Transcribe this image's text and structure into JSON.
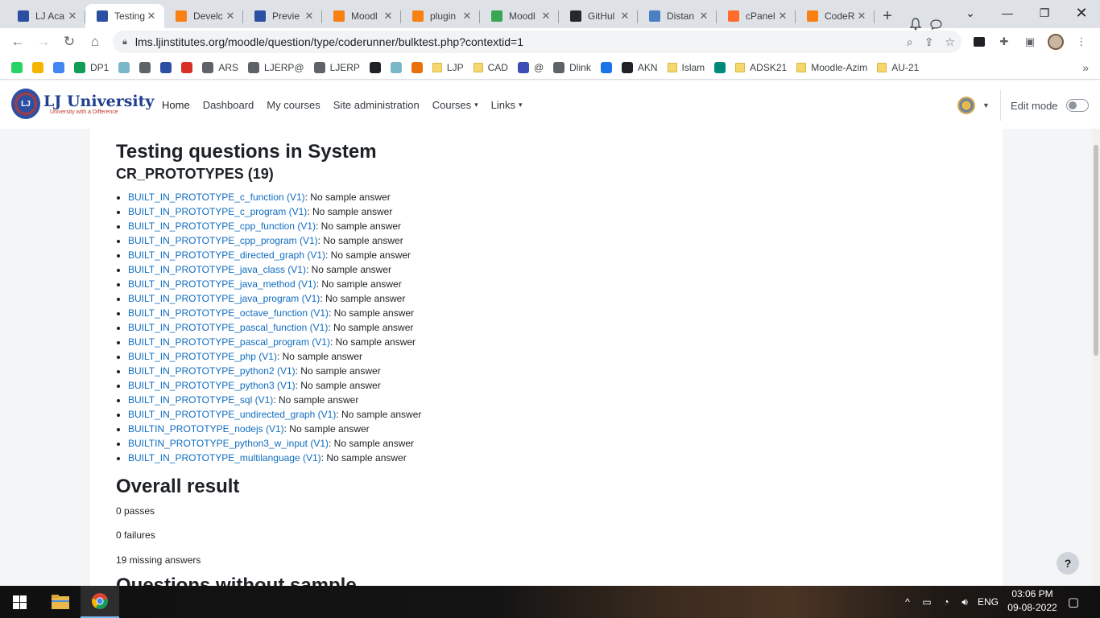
{
  "browser": {
    "tabs": [
      {
        "label": "LJ Aca",
        "icon": "shield-favicon",
        "color": "#2d4fa3",
        "active": false
      },
      {
        "label": "Testing",
        "icon": "shield-favicon",
        "color": "#2d4fa3",
        "active": true
      },
      {
        "label": "Develc",
        "icon": "moodle-favicon",
        "color": "#f98012",
        "active": false
      },
      {
        "label": "Previe",
        "icon": "shield-favicon",
        "color": "#2d4fa3",
        "active": false
      },
      {
        "label": "Moodl",
        "icon": "moodle-favicon",
        "color": "#f98012",
        "active": false
      },
      {
        "label": "plugin",
        "icon": "moodle-favicon",
        "color": "#f98012",
        "active": false
      },
      {
        "label": "Moodl",
        "icon": "moodle-green-favicon",
        "color": "#3aa655",
        "active": false
      },
      {
        "label": "GitHul",
        "icon": "github-favicon",
        "color": "#24292f",
        "active": false
      },
      {
        "label": "Distan",
        "icon": "doc-favicon",
        "color": "#4a7fc1",
        "active": false
      },
      {
        "label": "cPanel",
        "icon": "cpanel-favicon",
        "color": "#ff6c2c",
        "active": false
      },
      {
        "label": "CodeR",
        "icon": "moodle-favicon",
        "color": "#f98012",
        "active": false
      }
    ],
    "url": "lms.ljinstitutes.org/moodle/question/type/coderunner/bulktest.php?contextid=1",
    "bookmarks": [
      {
        "label": "",
        "icon": "whatsapp-icon",
        "color": "#25d366",
        "type": "icon"
      },
      {
        "label": "",
        "icon": "drive-icon",
        "color": "#f4b400",
        "type": "icon"
      },
      {
        "label": "",
        "icon": "google-icon",
        "color": "#4285f4",
        "type": "icon"
      },
      {
        "label": "DP1",
        "icon": "drive-icon",
        "color": "#0f9d58",
        "type": "icon"
      },
      {
        "label": "",
        "icon": "globe-icon",
        "color": "#7ab8c9",
        "type": "icon"
      },
      {
        "label": "",
        "icon": "globe-icon",
        "color": "#5f6368",
        "type": "icon"
      },
      {
        "label": "",
        "icon": "shield-icon",
        "color": "#2d4fa3",
        "type": "icon"
      },
      {
        "label": "",
        "icon": "bus-icon",
        "color": "#d93025",
        "type": "icon"
      },
      {
        "label": "ARS",
        "icon": "globe-icon",
        "color": "#5f6368",
        "type": "icon"
      },
      {
        "label": "LJERP@",
        "icon": "globe-icon",
        "color": "#5f6368",
        "type": "icon"
      },
      {
        "label": "LJERP",
        "icon": "globe-icon",
        "color": "#5f6368",
        "type": "icon"
      },
      {
        "label": "",
        "icon": "flame-icon",
        "color": "#202124",
        "type": "icon"
      },
      {
        "label": "",
        "icon": "globe-icon",
        "color": "#7ab8c9",
        "type": "icon"
      },
      {
        "label": "",
        "icon": "flame-icon",
        "color": "#e8710a",
        "type": "icon"
      },
      {
        "label": "LJP",
        "icon": "folder-icon",
        "color": "#f5d76e",
        "type": "folder"
      },
      {
        "label": "CAD",
        "icon": "folder-icon",
        "color": "#f5d76e",
        "type": "folder"
      },
      {
        "label": "@",
        "icon": "calendar-icon",
        "color": "#3c4db5",
        "type": "icon"
      },
      {
        "label": "Dlink",
        "icon": "globe-icon",
        "color": "#5f6368",
        "type": "icon"
      },
      {
        "label": "",
        "icon": "download-icon",
        "color": "#1a73e8",
        "type": "icon"
      },
      {
        "label": "AKN",
        "icon": "swoosh-icon",
        "color": "#202124",
        "type": "icon"
      },
      {
        "label": "Islam",
        "icon": "folder-icon",
        "color": "#f5d76e",
        "type": "folder"
      },
      {
        "label": "",
        "icon": "meet-icon",
        "color": "#00897b",
        "type": "icon"
      },
      {
        "label": "ADSK21",
        "icon": "folder-icon",
        "color": "#f5d76e",
        "type": "folder"
      },
      {
        "label": "Moodle-Azim",
        "icon": "folder-icon",
        "color": "#f5d76e",
        "type": "folder"
      },
      {
        "label": "AU-21",
        "icon": "folder-icon",
        "color": "#f5d76e",
        "type": "folder"
      }
    ]
  },
  "moodle": {
    "logo_name": "LJ University",
    "logo_tagline": "University with a Difference",
    "nav": [
      {
        "label": "Home",
        "active": true,
        "caret": false
      },
      {
        "label": "Dashboard",
        "active": false,
        "caret": false
      },
      {
        "label": "My courses",
        "active": false,
        "caret": false
      },
      {
        "label": "Site administration",
        "active": false,
        "caret": false
      },
      {
        "label": "Courses",
        "active": false,
        "caret": true
      },
      {
        "label": "Links",
        "active": false,
        "caret": true
      }
    ],
    "edit_mode_label": "Edit mode"
  },
  "page": {
    "title": "Testing questions in System",
    "category": "CR_PROTOTYPES (19)",
    "questions": [
      {
        "name": "BUILT_IN_PROTOTYPE_c_function (V1)",
        "result": ": No sample answer"
      },
      {
        "name": "BUILT_IN_PROTOTYPE_c_program (V1)",
        "result": ": No sample answer"
      },
      {
        "name": "BUILT_IN_PROTOTYPE_cpp_function (V1)",
        "result": ": No sample answer"
      },
      {
        "name": "BUILT_IN_PROTOTYPE_cpp_program (V1)",
        "result": ": No sample answer"
      },
      {
        "name": "BUILT_IN_PROTOTYPE_directed_graph (V1)",
        "result": ": No sample answer"
      },
      {
        "name": "BUILT_IN_PROTOTYPE_java_class (V1)",
        "result": ": No sample answer"
      },
      {
        "name": "BUILT_IN_PROTOTYPE_java_method (V1)",
        "result": ": No sample answer"
      },
      {
        "name": "BUILT_IN_PROTOTYPE_java_program (V1)",
        "result": ": No sample answer"
      },
      {
        "name": "BUILT_IN_PROTOTYPE_octave_function (V1)",
        "result": ": No sample answer"
      },
      {
        "name": "BUILT_IN_PROTOTYPE_pascal_function (V1)",
        "result": ": No sample answer"
      },
      {
        "name": "BUILT_IN_PROTOTYPE_pascal_program (V1)",
        "result": ": No sample answer"
      },
      {
        "name": "BUILT_IN_PROTOTYPE_php (V1)",
        "result": ": No sample answer"
      },
      {
        "name": "BUILT_IN_PROTOTYPE_python2 (V1)",
        "result": ": No sample answer"
      },
      {
        "name": "BUILT_IN_PROTOTYPE_python3 (V1)",
        "result": ": No sample answer"
      },
      {
        "name": "BUILT_IN_PROTOTYPE_sql (V1)",
        "result": ": No sample answer"
      },
      {
        "name": "BUILT_IN_PROTOTYPE_undirected_graph (V1)",
        "result": ": No sample answer"
      },
      {
        "name": "BUILTIN_PROTOTYPE_nodejs (V1)",
        "result": ": No sample answer"
      },
      {
        "name": "BUILTIN_PROTOTYPE_python3_w_input (V1)",
        "result": ": No sample answer"
      },
      {
        "name": "BUILT_IN_PROTOTYPE_multilanguage (V1)",
        "result": ": No sample answer"
      }
    ],
    "overall_title": "Overall result",
    "passes": "0 passes",
    "failures": "0 failures",
    "missing": "19 missing answers",
    "next_heading": "Questions without sample"
  },
  "taskbar": {
    "lang": "ENG",
    "time": "03:06 PM",
    "date": "09-08-2022"
  },
  "colors": {
    "link": "#0f6cbf",
    "brand": "#1f3f8e"
  }
}
